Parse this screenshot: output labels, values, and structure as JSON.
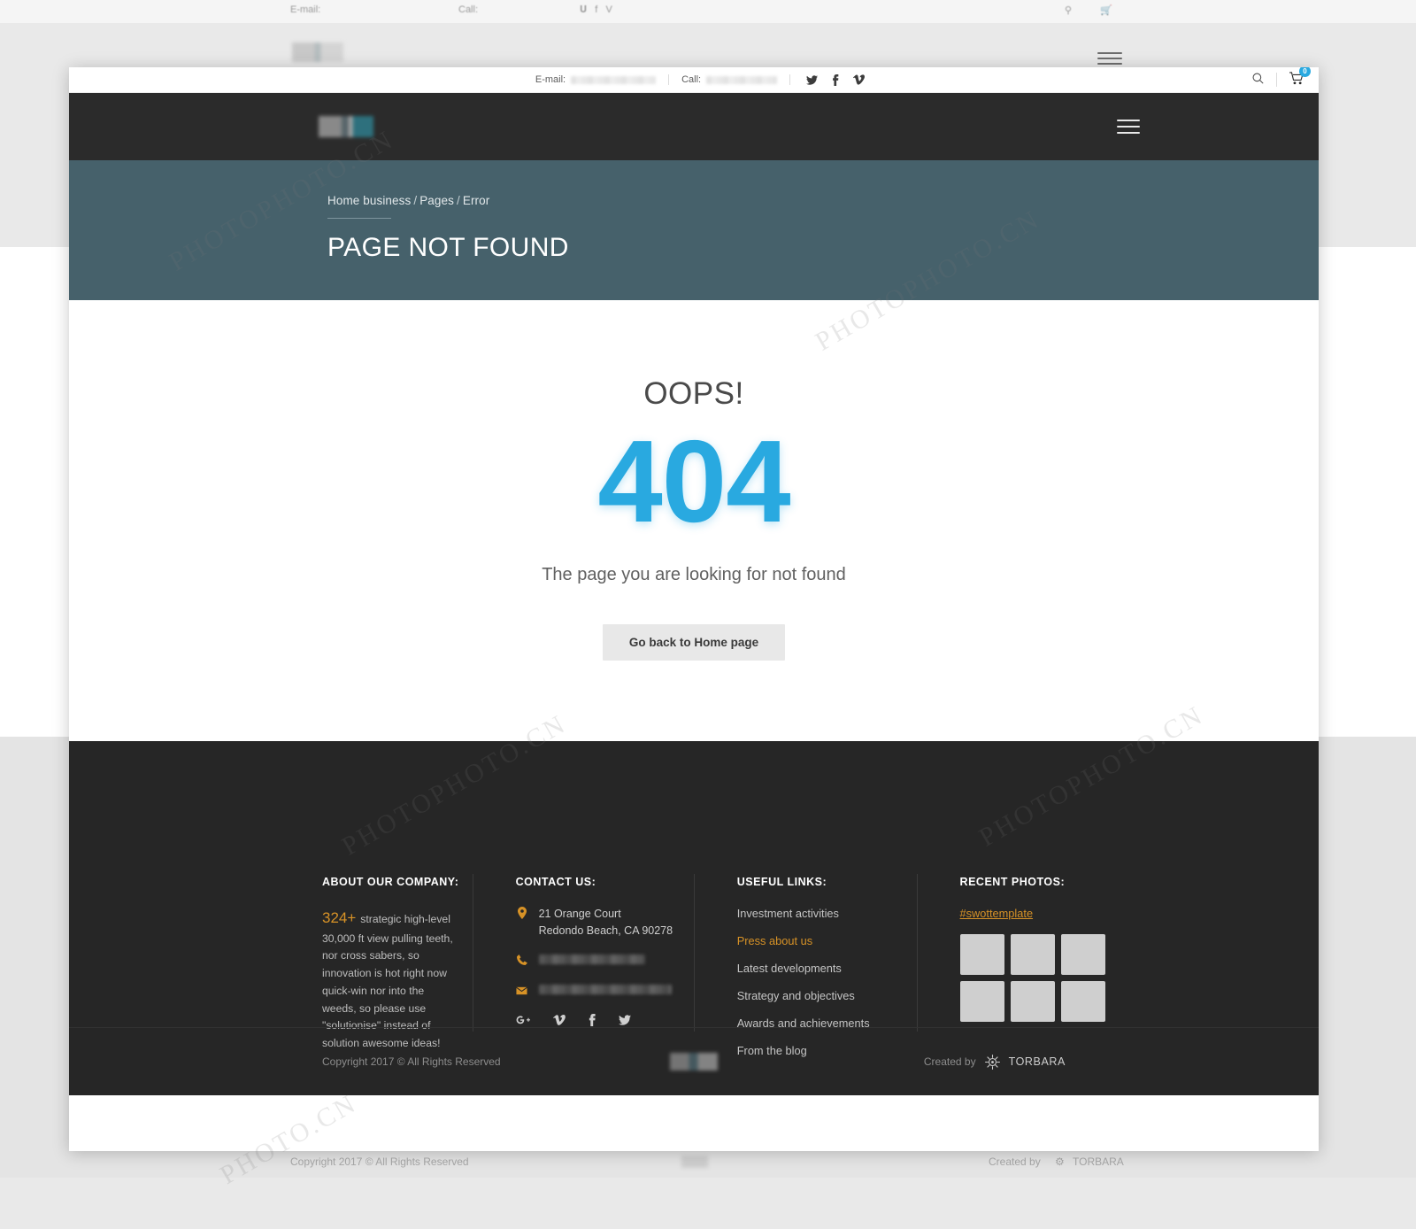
{
  "topbar": {
    "email_label": "E-mail:",
    "email_value": "",
    "call_label": "Call:",
    "call_value": "",
    "social": [
      "twitter-icon",
      "facebook-icon",
      "vimeo-icon"
    ],
    "search_icon": "search-icon",
    "cart_icon": "cart-icon",
    "cart_count": "0"
  },
  "header": {
    "logo": "site-logo",
    "menu_icon": "hamburger-menu-icon"
  },
  "hero": {
    "breadcrumb": [
      {
        "label": "Home business"
      },
      {
        "label": "Pages"
      },
      {
        "label": "Error"
      }
    ],
    "separator": "/",
    "title": "PAGE NOT FOUND",
    "bg_color": "#46616b"
  },
  "error_page": {
    "oops": "OOPS!",
    "code": "404",
    "code_color": "#29a9e0",
    "message": "The page you are looking for not found",
    "button_label": "Go back to Home page"
  },
  "footer": {
    "about": {
      "heading": "ABOUT OUR COMPANY:",
      "highlight": "324+",
      "highlight_color": "#d79226",
      "text": "strategic high-level 30,000 ft view pulling teeth, nor cross sabers, so innovation is hot right now quick-win nor into the weeds, so please use \"solutionise\" instead of solution awesome ideas!"
    },
    "contact": {
      "heading": "CONTACT US:",
      "address_icon": "location-pin-icon",
      "address_line1": "21 Orange Court",
      "address_line2": "Redondo Beach, CA 90278",
      "phone_icon": "phone-icon",
      "phone_value": "",
      "email_icon": "envelope-icon",
      "email_value": "",
      "social": [
        "google-plus-icon",
        "vimeo-icon",
        "facebook-icon",
        "twitter-icon"
      ]
    },
    "links": {
      "heading": "USEFUL LINKS:",
      "items": [
        {
          "label": "Investment activities",
          "active": false
        },
        {
          "label": "Press about us",
          "active": true
        },
        {
          "label": "Latest developments",
          "active": false
        },
        {
          "label": "Strategy and objectives",
          "active": false
        },
        {
          "label": "Awards and achievements",
          "active": false
        },
        {
          "label": "From the blog",
          "active": false
        }
      ]
    },
    "photos": {
      "heading": "RECENT PHOTOS:",
      "tag": "#swottemplate",
      "count": 6
    }
  },
  "copyright": {
    "text": "Copyright 2017  ©  All Rights Reserved",
    "created_by": "Created by",
    "brand": "TORBARA"
  },
  "backdrop": {
    "topbar_email_label": "E-mail:",
    "topbar_call_label": "Call:",
    "bottom_copyright": "Copyright 2017  ©  All Rights Reserved",
    "bottom_created_by": "Created by",
    "bottom_brand": "TORBARA"
  }
}
